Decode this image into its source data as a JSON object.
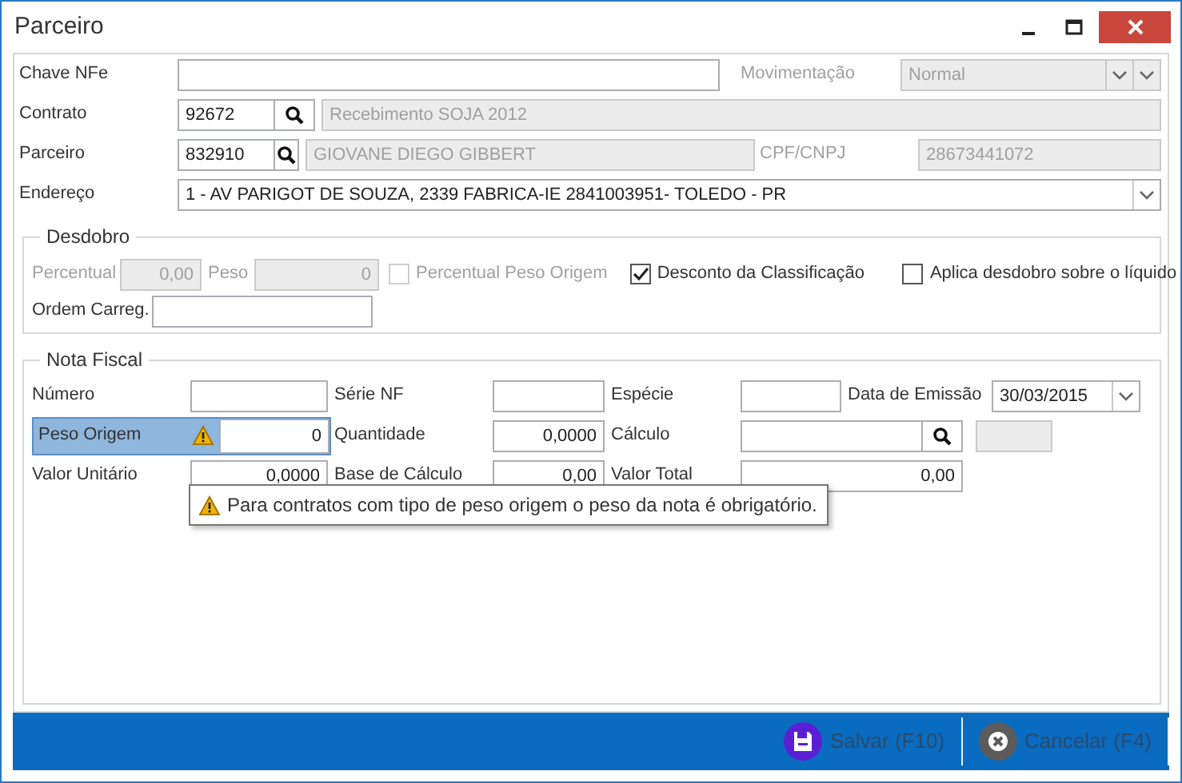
{
  "window": {
    "title": "Parceiro"
  },
  "header": {
    "chave_nfe": {
      "label": "Chave NFe"
    },
    "movimentacao": {
      "label": "Movimentação",
      "value": "Normal",
      "disabled": true
    },
    "contrato": {
      "label": "Contrato",
      "code": "92672",
      "description": "Recebimento SOJA 2012"
    },
    "parceiro": {
      "label": "Parceiro",
      "code": "832910",
      "name": "GIOVANE DIEGO GIBBERT"
    },
    "cpf_cnpj": {
      "label": "CPF/CNPJ",
      "value": "28673441072",
      "disabled": true
    },
    "endereco": {
      "label": "Endereço",
      "value": "1 - AV PARIGOT DE SOUZA, 2339 FABRICA-IE 2841003951- TOLEDO - PR"
    }
  },
  "desdobro": {
    "title": "Desdobro",
    "percentual": {
      "label": "Percentual",
      "value": "0,00",
      "disabled": true
    },
    "peso": {
      "label": "Peso",
      "value": "0",
      "disabled": true
    },
    "checks": [
      {
        "label": "Percentual Peso Origem",
        "checked": false,
        "disabled": true
      },
      {
        "label": "Desconto da Classificação",
        "checked": true,
        "disabled": false
      },
      {
        "label": "Aplica desdobro sobre o líquido",
        "checked": false,
        "disabled": false
      }
    ],
    "ordem_carreg": {
      "label": "Ordem Carreg."
    }
  },
  "nota_fiscal": {
    "title": "Nota Fiscal",
    "numero": {
      "label": "Número"
    },
    "serie_nf": {
      "label": "Série NF"
    },
    "especie": {
      "label": "Espécie"
    },
    "data_emissao": {
      "label": "Data de Emissão",
      "value": "30/03/2015"
    },
    "peso_origem": {
      "label": "Peso Origem",
      "value": "0",
      "invalid": true
    },
    "quantidade": {
      "label": "Quantidade",
      "value": "0,0000"
    },
    "calculo": {
      "label": "Cálculo"
    },
    "valor_unitario": {
      "label": "Valor Unitário",
      "value": "0,0000"
    },
    "base_calculo": {
      "label": "Base de Cálculo",
      "value": "0,00"
    },
    "valor_total": {
      "label": "Valor Total",
      "value": "0,00"
    },
    "tooltip": "Para contratos com tipo de peso origem o peso da nota é obrigatório."
  },
  "footer": {
    "buttons": [
      {
        "label": "Salvar (F10)",
        "kind": "save"
      },
      {
        "label": "Cancelar (F4)",
        "kind": "cancel"
      }
    ]
  }
}
